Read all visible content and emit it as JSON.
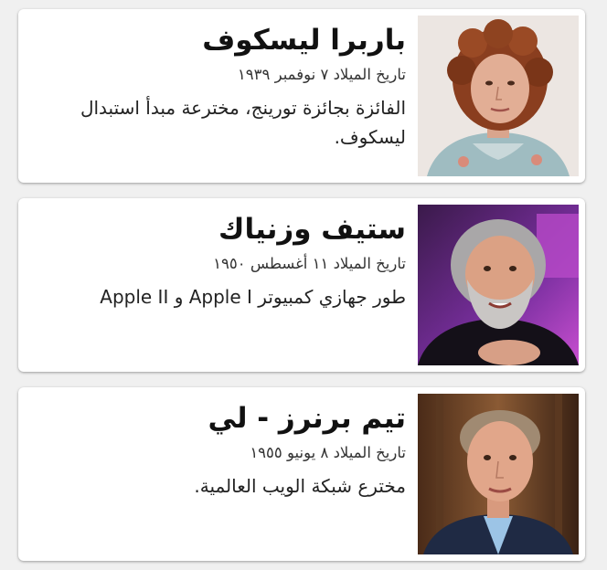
{
  "people": [
    {
      "name": "باربرا ليسكوف",
      "dob": "تاريخ الميلاد ٧ نوفمبر ١٩٣٩",
      "description": "الفائزة بجائزة تورينج، مخترعة مبدأ استبدال ليسكوف.",
      "photo_icon": "portrait-barbara-liskov"
    },
    {
      "name": "ستيف وزنياك",
      "dob": "تاريخ الميلاد ١١ أغسطس ١٩٥٠",
      "description": "طور جهازي كمبيوتر Apple I و Apple II",
      "photo_icon": "portrait-steve-wozniak"
    },
    {
      "name": "تيم برنرز - لي",
      "dob": "تاريخ الميلاد ٨ يونيو ١٩٥٥",
      "description": "مخترع شبكة الويب العالمية.",
      "photo_icon": "portrait-tim-berners-lee"
    }
  ]
}
